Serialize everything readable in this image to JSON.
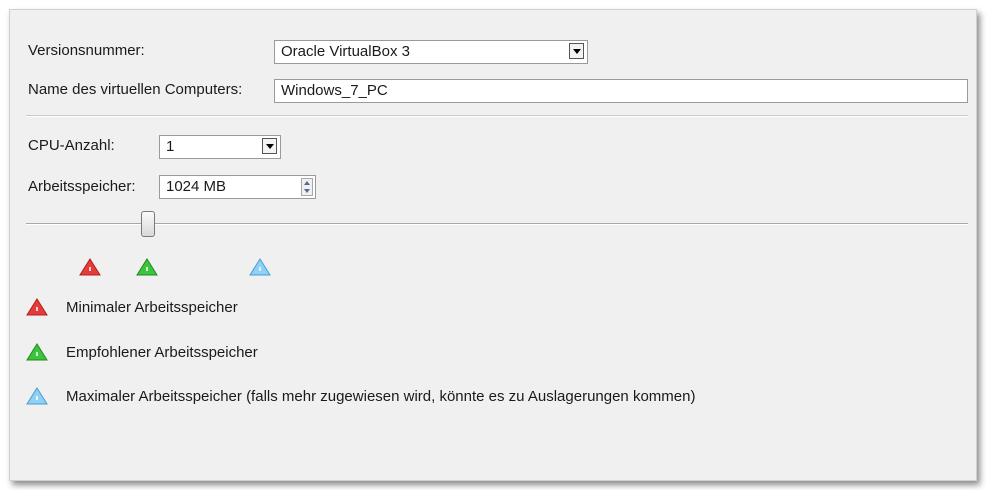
{
  "form": {
    "version_label": "Versionsnummer:",
    "version_value": "Oracle VirtualBox 3",
    "name_label": "Name des virtuellen Computers:",
    "name_value": "Windows_7_PC",
    "cpu_label": "CPU-Anzahl:",
    "cpu_value": "1",
    "ram_label": "Arbeitsspeicher:",
    "ram_value": "1024 MB"
  },
  "slider": {
    "memory_level_fraction": 0.13
  },
  "legend": {
    "min_label": "Minimaler Arbeitsspeicher",
    "recommended_label": "Empfohlener Arbeitsspeicher",
    "max_label": "Maximaler Arbeitsspeicher (falls mehr zugewiesen wird, könnte es zu Auslagerungen kommen)"
  },
  "colors": {
    "min": "#e53b3b",
    "recommended": "#3cc43c",
    "max": "#8fd0f5"
  },
  "icons": {
    "min_marker": "warning-triangle-red-icon",
    "recommended_marker": "triangle-green-icon",
    "max_marker": "triangle-blue-icon"
  }
}
